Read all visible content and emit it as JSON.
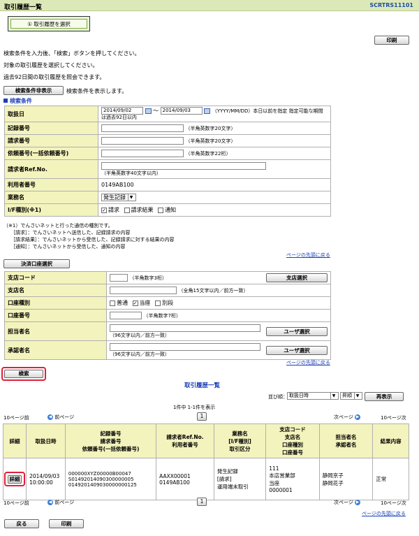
{
  "header": {
    "title": "取引履歴一覧",
    "screen_id": "SCRTRS11101"
  },
  "step": {
    "label": "① 取引履歴を選択"
  },
  "buttons": {
    "print": "印刷",
    "toggle_conditions": "検索条件非表示",
    "account_select": "決済口座選択",
    "branch_select": "支店選択",
    "user_select": "ユーザ選択",
    "search": "検索",
    "redisplay": "再表示",
    "detail": "詳細",
    "back": "戻る",
    "print_bottom": "印刷"
  },
  "instructions": [
    "検索条件を入力後、「検索」ボタンを押してください。",
    "対象の取引履歴を選択してください。",
    "過去92日間の取引履歴を照会できます。"
  ],
  "toggle_note": "検索条件を表示します。",
  "conditions": {
    "heading": "検索条件",
    "date_label": "取扱日",
    "date_from": "2014/09/02",
    "date_to": "2014/09/03",
    "date_tilde": "～",
    "date_note1": "（YYYY/MM/DD）本日以前を指定 指定可能な期間",
    "date_note2": "は過去92日以内",
    "record_label": "記録番号",
    "record_note": "（半角英数字20文字）",
    "request_label": "請求番号",
    "request_note": "（半角英数字20文字）",
    "bulk_label": "依頼番号(一括依頼番号)",
    "bulk_note": "（半角英数字22桁）",
    "ref_label": "請求者Ref.No.",
    "ref_note": "（半角英数字40文字以内）",
    "user_label": "利用者番号",
    "user_value": "0149AB100",
    "business_label": "業務名",
    "business_value": "発生記録",
    "if_label": "I/F種別(※1)",
    "if_options": [
      "請求",
      "請求結果",
      "通知"
    ]
  },
  "footnote": [
    "（※1）でんさいネットと行った通信の種別です。",
    "［請求］：でんさいネットへ送信した、記録請求の内容",
    "［請求結果］：でんさいネットから受信した、記録請求に対する結果の内容",
    "［通知］：でんさいネットから受信した、通知の内容"
  ],
  "top_link": "ページの先頭に戻る",
  "account": {
    "branch_code_label": "支店コード",
    "branch_code_note": "（半角数字3桁）",
    "branch_name_label": "支店名",
    "branch_name_note": "（全角15文字以内／前方一致）",
    "type_label": "口座種別",
    "type_options": [
      "普通",
      "当座",
      "別段"
    ],
    "number_label": "口座番号",
    "number_note": "（半角数字7桁）",
    "owner_label": "担当者名",
    "owner_note": "（96文字以内／前方一致）",
    "approver_label": "承認者名",
    "approver_note": "（96文字以内／前方一致）"
  },
  "results": {
    "heading": "取引履歴一覧",
    "sort_label": "並び順：",
    "sort_value": "取扱日時",
    "order_value": "昇順",
    "count": "1件中 1-1件を表示",
    "pager": {
      "prev10": "10ページ前",
      "prev": "前ページ",
      "page": "1",
      "next": "次ページ",
      "next10": "10ページ次"
    },
    "columns": [
      "詳細",
      "取扱日時",
      "記録番号\n請求番号\n依頼番号(一括依頼番号)",
      "請求者Ref.No.\n利用者番号",
      "業務名\n[I/F種別]\n取引区分",
      "支店コード\n支店名\n口座種別\n口座番号",
      "担当者名\n承認者名",
      "結果内容"
    ],
    "row": {
      "datetime1": "2014/09/03",
      "datetime2": "10:00:00",
      "record": "000000XYZ00000B00047",
      "request": "S01492014090300000005",
      "bulk": "0149201409030000000125",
      "ref": "AAXX00001",
      "user": "0149AB100",
      "business": "発生記録",
      "if_type": "[請求]",
      "category": "運用端末取引",
      "branch_code": "111",
      "branch_name": "本店営業部",
      "acct_type": "当座",
      "acct_no": "0000001",
      "owner": "静岡京子",
      "approver": "静岡花子",
      "result": "正常"
    }
  }
}
